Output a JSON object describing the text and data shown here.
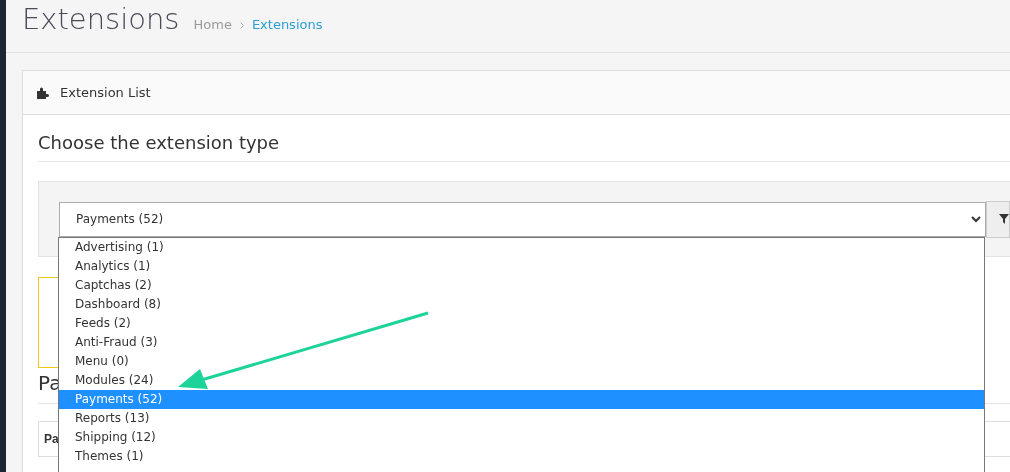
{
  "page": {
    "title": "Extensions",
    "breadcrumb": [
      {
        "label": "Home",
        "current": false
      },
      {
        "label": "Extensions",
        "current": true
      }
    ]
  },
  "panel": {
    "title": "Extension List"
  },
  "section": {
    "heading": "Choose the extension type"
  },
  "select": {
    "value": "Payments (52)",
    "options": [
      {
        "label": "Advertising (1)",
        "selected": false
      },
      {
        "label": "Analytics (1)",
        "selected": false
      },
      {
        "label": "Captchas (2)",
        "selected": false
      },
      {
        "label": "Dashboard (8)",
        "selected": false
      },
      {
        "label": "Feeds (2)",
        "selected": false
      },
      {
        "label": "Anti-Fraud (3)",
        "selected": false
      },
      {
        "label": "Menu (0)",
        "selected": false
      },
      {
        "label": "Modules (24)",
        "selected": false
      },
      {
        "label": "Payments (52)",
        "selected": true
      },
      {
        "label": "Reports (13)",
        "selected": false
      },
      {
        "label": "Shipping (12)",
        "selected": false
      },
      {
        "label": "Themes (1)",
        "selected": false
      }
    ]
  },
  "list_heading": "Pa",
  "table": {
    "columns": [
      "Pa"
    ]
  }
}
